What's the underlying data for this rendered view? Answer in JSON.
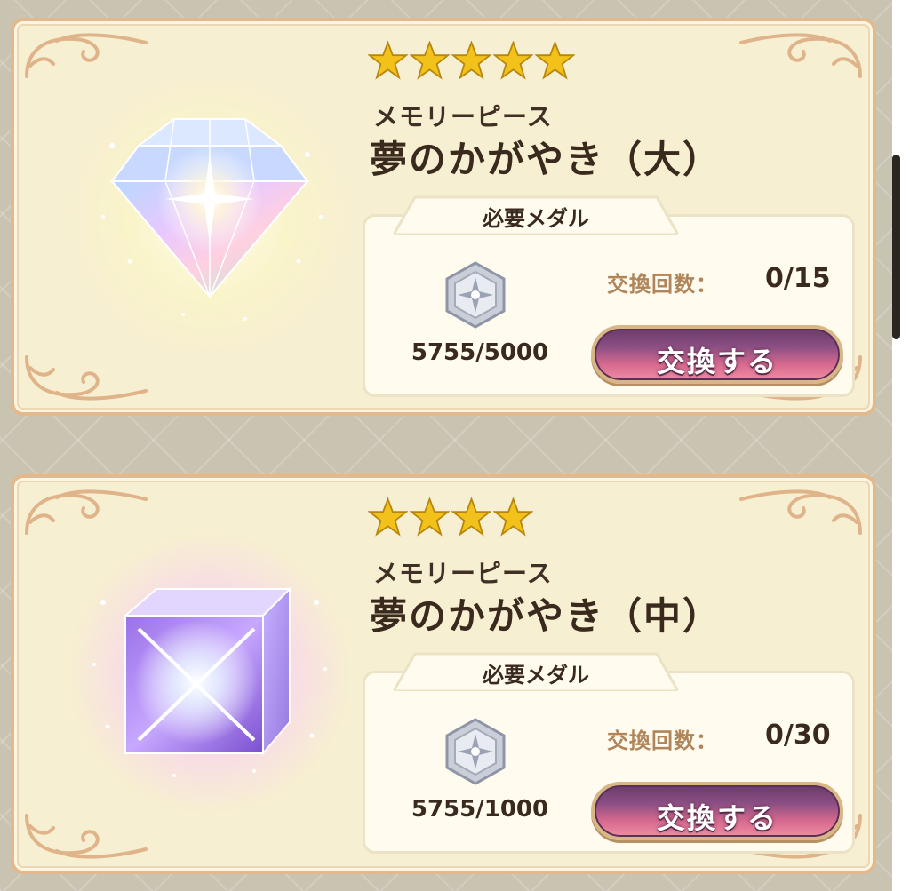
{
  "items": [
    {
      "stars": 5,
      "subtitle": "メモリーピース",
      "title": "夢のかがやき（大）",
      "gem": "diamond-gem",
      "medal_header": "必要メダル",
      "medal_icon": "silver-medal-icon",
      "medal_count": "5755/5000",
      "exchange_count_label": "交換回数：",
      "exchange_count": "0/15",
      "exchange_button": "交換する"
    },
    {
      "stars": 4,
      "subtitle": "メモリーピース",
      "title": "夢のかがやき（中）",
      "gem": "cube-gem",
      "medal_header": "必要メダル",
      "medal_icon": "silver-medal-icon",
      "medal_count": "5755/1000",
      "exchange_count_label": "交換回数：",
      "exchange_count": "0/30",
      "exchange_button": "交換する"
    }
  ],
  "colors": {
    "card_border": "#e2b98c",
    "card_bg": "#f7efd1",
    "star_gold": "#f2c21b",
    "button_purple": "#6a3b6a",
    "button_pink": "#ef8ea5",
    "label_brown": "#b0855a"
  }
}
